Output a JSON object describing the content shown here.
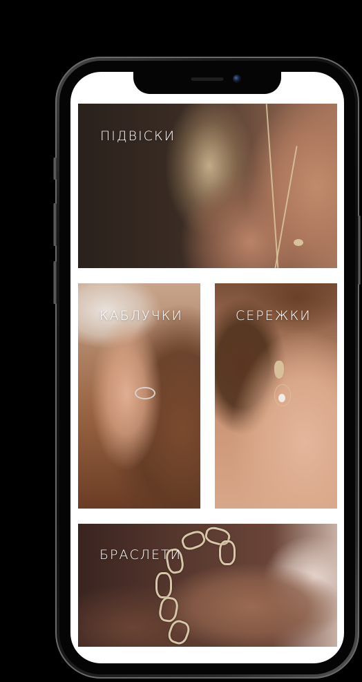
{
  "categories": {
    "pendants": {
      "label": "ПІДВІСКИ"
    },
    "rings": {
      "label": "КАБЛУЧКИ"
    },
    "earrings": {
      "label": "СЕРЕЖКИ"
    },
    "bracelets": {
      "label": "БРАСЛЕТИ"
    }
  },
  "colors": {
    "screen_background": "#ffffff",
    "phone_frame": "#1a1a1a",
    "label_text": "#ffffff"
  }
}
